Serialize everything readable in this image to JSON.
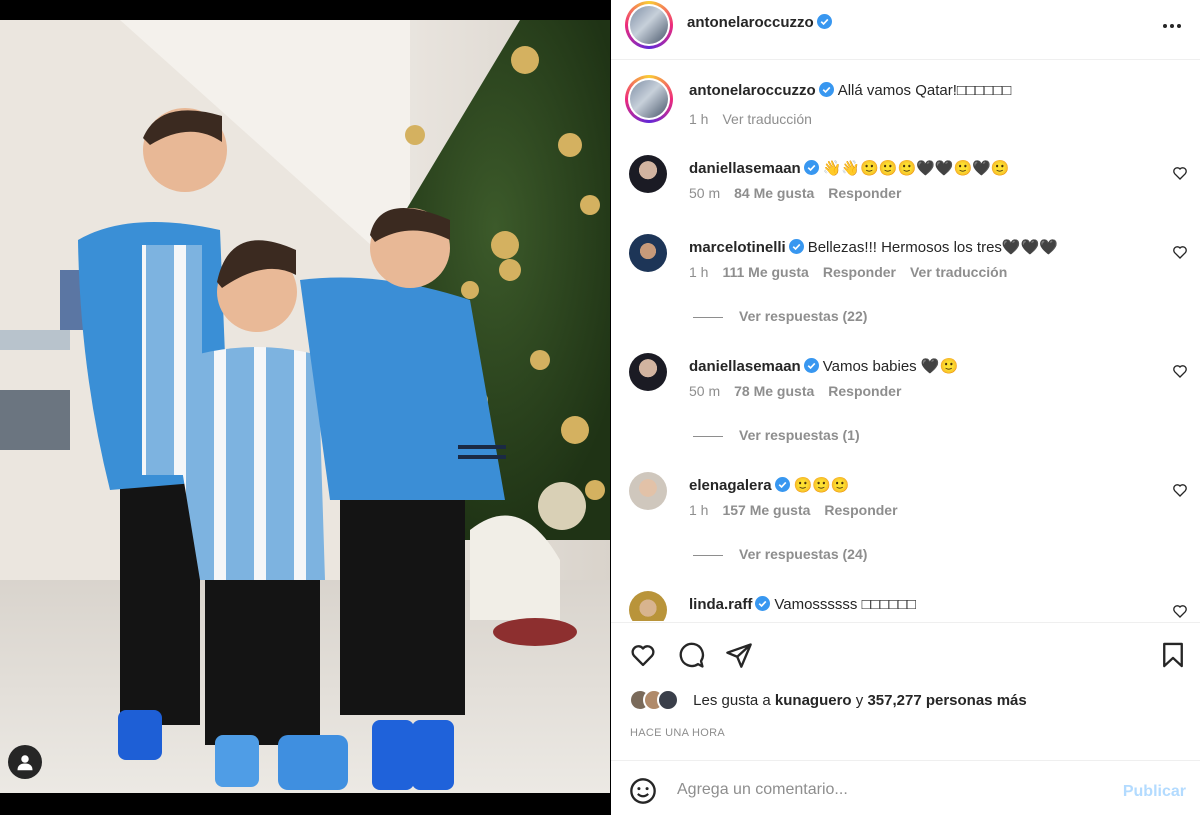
{
  "post": {
    "author": "antonelaroccuzzo",
    "caption_user": "antonelaroccuzzo",
    "caption": "Allá vamos Qatar!□□□□□□",
    "caption_time": "1 h",
    "caption_translate": "Ver traducción"
  },
  "comments": [
    {
      "user": "daniellasemaan",
      "verified": true,
      "text": "👋👋🙂🙂🙂🖤🖤🙂🖤🙂",
      "time": "50 m",
      "likes": "84 Me gusta",
      "reply": "Responder",
      "translate": "",
      "view_replies": ""
    },
    {
      "user": "marcelotinelli",
      "verified": true,
      "text": "Bellezas!!! Hermosos los tres🖤🖤🖤",
      "time": "1 h",
      "likes": "111 Me gusta",
      "reply": "Responder",
      "translate": "Ver traducción",
      "view_replies": "Ver respuestas (22)"
    },
    {
      "user": "daniellasemaan",
      "verified": true,
      "text": "Vamos babies 🖤🙂",
      "time": "50 m",
      "likes": "78 Me gusta",
      "reply": "Responder",
      "translate": "",
      "view_replies": "Ver respuestas (1)"
    },
    {
      "user": "elenagalera",
      "verified": true,
      "text": "🙂🙂🙂",
      "time": "1 h",
      "likes": "157 Me gusta",
      "reply": "Responder",
      "translate": "",
      "view_replies": "Ver respuestas (24)"
    },
    {
      "user": "linda.raff",
      "verified": true,
      "text": "Vamossssss □□□□□□",
      "time": "",
      "likes": "",
      "reply": "",
      "translate": "",
      "view_replies": ""
    }
  ],
  "likes": {
    "prefix": "Les gusta a",
    "user": "kunaguero",
    "connector": "y",
    "count": "357,277 personas más"
  },
  "timestamp": "HACE UNA HORA",
  "composer": {
    "placeholder": "Agrega un comentario...",
    "publish": "Publicar"
  },
  "colors": {
    "verified": "#3897f0",
    "publish_disabled": "#b3dbff",
    "muted": "#8e8e8e"
  },
  "icons": [
    "more-icon",
    "heart-icon",
    "comment-icon",
    "share-icon",
    "bookmark-icon",
    "emoji-icon",
    "user-tag-icon",
    "verified-icon"
  ]
}
